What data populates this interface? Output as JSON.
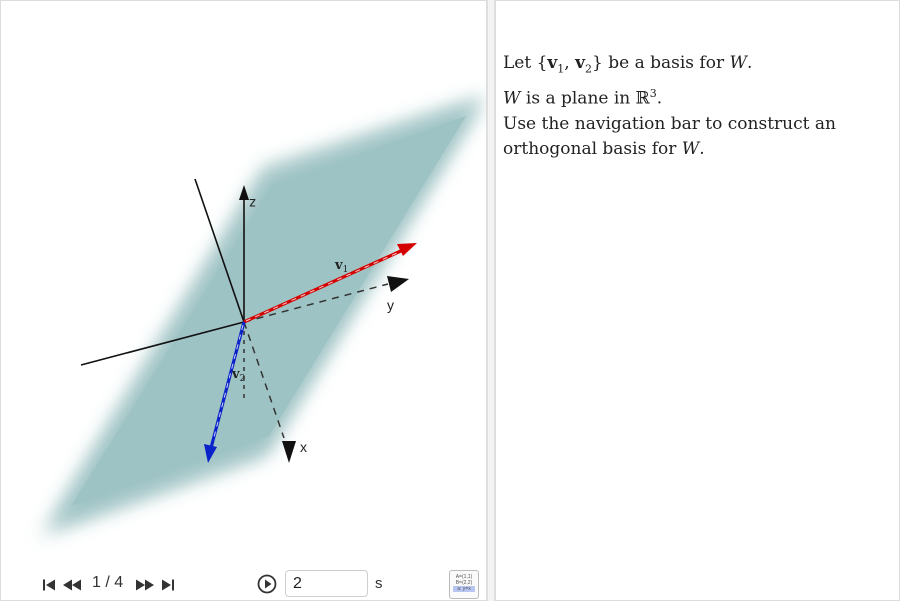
{
  "text_panel": {
    "line1": {
      "prefix": "Let {",
      "v1": "v",
      "v1_sub": "1",
      "comma": ", ",
      "v2": "v",
      "v2_sub": "2",
      "suffix": "} be a basis for ",
      "W": "W",
      "end": "."
    },
    "line2": {
      "W": "W",
      "mid": " is a plane in ",
      "R": "ℝ",
      "sup": "3",
      "end": "."
    },
    "line3": "Use the navigation bar to construct an",
    "line4": {
      "prefix": "orthogonal basis for ",
      "W": "W",
      "end": "."
    }
  },
  "scene": {
    "axis_labels": {
      "x": "x",
      "y": "y",
      "z": "z"
    },
    "vector_labels": {
      "v1": "v",
      "v1_sub": "1",
      "v2": "v",
      "v2_sub": "2"
    },
    "colors": {
      "plane": "#9dc2c4",
      "v1": "#d40000",
      "v2": "#0a22c9",
      "axis": "#111111"
    }
  },
  "navigation": {
    "step_text": "1 / 4",
    "speed_value": "2",
    "speed_unit": "s",
    "icons": [
      "skip-first-icon",
      "step-back-icon",
      "step-forward-icon",
      "skip-last-icon",
      "play-icon"
    ],
    "algebra_toggle_lines": [
      "A=(1,1)",
      "B=(2,2)",
      "a: y=x"
    ]
  }
}
